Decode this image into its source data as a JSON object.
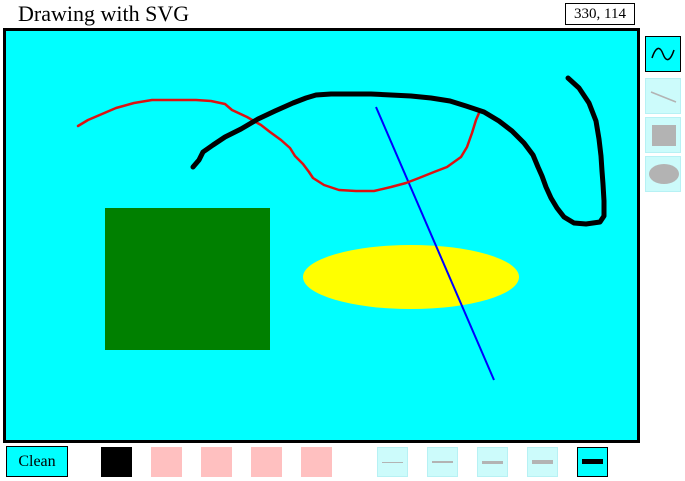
{
  "app": {
    "title": "Drawing with SVG",
    "cursor_readout": "330, 114"
  },
  "canvas": {
    "background": "#00ffff",
    "shapes": [
      {
        "type": "freehand",
        "color": "#dd1111"
      },
      {
        "type": "freehand",
        "color": "#000000"
      },
      {
        "type": "line",
        "color": "#0000ff"
      },
      {
        "type": "rect",
        "color": "#008000"
      },
      {
        "type": "ellipse",
        "color": "#ffff00"
      }
    ]
  },
  "tools": [
    {
      "id": "freehand",
      "icon": "freehand-curve-icon",
      "selected": true
    },
    {
      "id": "line",
      "icon": "line-icon",
      "selected": false
    },
    {
      "id": "rect",
      "icon": "rectangle-icon",
      "selected": false
    },
    {
      "id": "ellipse",
      "icon": "ellipse-icon",
      "selected": false
    }
  ],
  "toolbar": {
    "clean_label": "Clean"
  },
  "colors": [
    "#000000",
    "#ffc0c0",
    "#ffc0c0",
    "#ffc0c0",
    "#ffc0c0"
  ],
  "stroke_widths": [
    {
      "level": 1,
      "selected": false
    },
    {
      "level": 2,
      "selected": false
    },
    {
      "level": 3,
      "selected": false
    },
    {
      "level": 4,
      "selected": false
    },
    {
      "level": 5,
      "selected": true
    }
  ]
}
